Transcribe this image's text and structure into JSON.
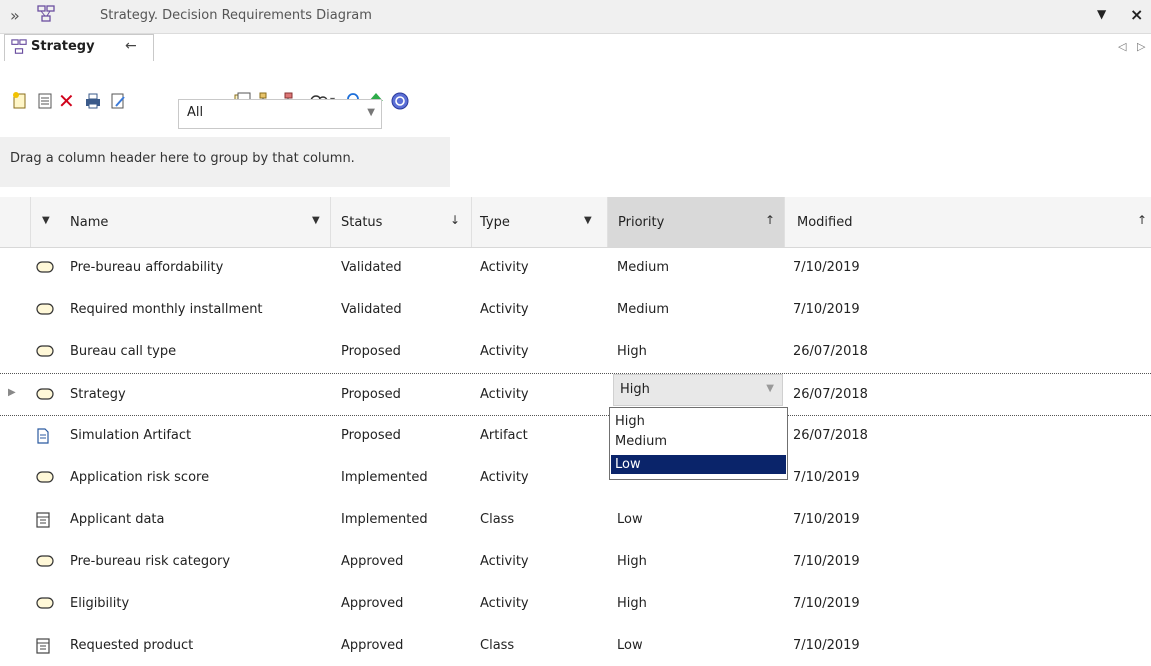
{
  "window": {
    "title": "Strategy. Decision Requirements Diagram"
  },
  "tab": {
    "label": "Strategy"
  },
  "toolbar": {
    "filter_value": "All"
  },
  "group_hint": "Drag a column header here to group by that column.",
  "columns": {
    "name": "Name",
    "status": "Status",
    "type": "Type",
    "priority": "Priority",
    "modified": "Modified"
  },
  "rows": [
    {
      "icon": "activity-icon",
      "name": "Pre-bureau affordability",
      "status": "Validated",
      "type": "Activity",
      "priority": "Medium",
      "modified": "7/10/2019"
    },
    {
      "icon": "activity-icon",
      "name": "Required monthly installment",
      "status": "Validated",
      "type": "Activity",
      "priority": "Medium",
      "modified": "7/10/2019"
    },
    {
      "icon": "activity-icon",
      "name": "Bureau call type",
      "status": "Proposed",
      "type": "Activity",
      "priority": "High",
      "modified": "26/07/2018"
    },
    {
      "icon": "activity-icon",
      "name": "Strategy",
      "status": "Proposed",
      "type": "Activity",
      "priority": "High",
      "modified": "26/07/2018"
    },
    {
      "icon": "artifact-icon",
      "name": "Simulation Artifact",
      "status": "Proposed",
      "type": "Artifact",
      "priority": "",
      "modified": "26/07/2018"
    },
    {
      "icon": "activity-icon",
      "name": "Application risk score",
      "status": "Implemented",
      "type": "Activity",
      "priority": "",
      "modified": "7/10/2019"
    },
    {
      "icon": "class-icon",
      "name": "Applicant data",
      "status": "Implemented",
      "type": "Class",
      "priority": "Low",
      "modified": "7/10/2019"
    },
    {
      "icon": "activity-icon",
      "name": "Pre-bureau risk category",
      "status": "Approved",
      "type": "Activity",
      "priority": "High",
      "modified": "7/10/2019"
    },
    {
      "icon": "activity-icon",
      "name": "Eligibility",
      "status": "Approved",
      "type": "Activity",
      "priority": "High",
      "modified": "7/10/2019"
    },
    {
      "icon": "class-icon",
      "name": "Requested product",
      "status": "Approved",
      "type": "Class",
      "priority": "Low",
      "modified": "7/10/2019"
    }
  ],
  "priority_editor": {
    "value": "High",
    "options": [
      "High",
      "Medium",
      "Low"
    ],
    "highlighted": "Low"
  },
  "colors": {
    "selection": "#0a246a",
    "header_bg": "#f5f5f5",
    "group_bg": "#f0f0f0"
  }
}
